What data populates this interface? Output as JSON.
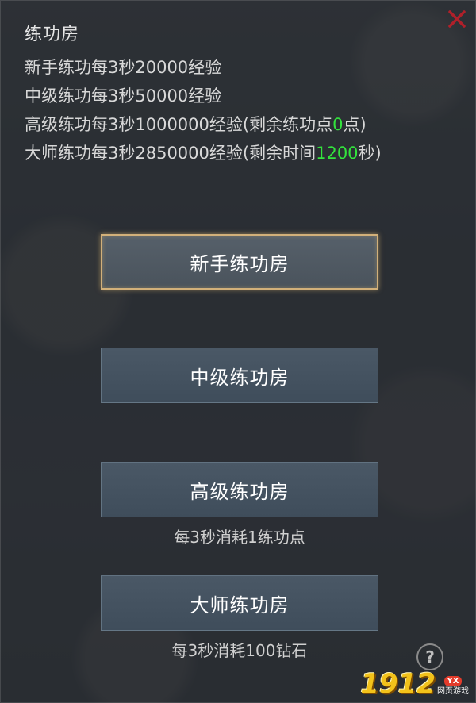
{
  "title": "练功房",
  "info_lines": [
    {
      "text": "新手练功每3秒20000经验"
    },
    {
      "text": "中级练功每3秒50000经验"
    },
    {
      "prefix": "高级练功每3秒1000000经验(剩余练功点",
      "value": "0",
      "suffix": "点)"
    },
    {
      "prefix": "大师练功每3秒2850000经验(剩余时间",
      "value": "1200",
      "suffix": "秒)"
    }
  ],
  "rooms": [
    {
      "label": "新手练功房",
      "selected": true
    },
    {
      "label": "中级练功房",
      "selected": false
    },
    {
      "label": "高级练功房",
      "selected": false,
      "cost": "每3秒消耗1练功点"
    },
    {
      "label": "大师练功房",
      "selected": false,
      "cost": "每3秒消耗100钻石"
    }
  ],
  "help_symbol": "?",
  "close_icon": "close-x-icon",
  "watermark": {
    "number": "1912",
    "badge": "YX",
    "sub": "网页游戏"
  },
  "colors": {
    "highlight": "#33e33d",
    "selected_border": "#d2b07a",
    "close": "#b0202a"
  }
}
